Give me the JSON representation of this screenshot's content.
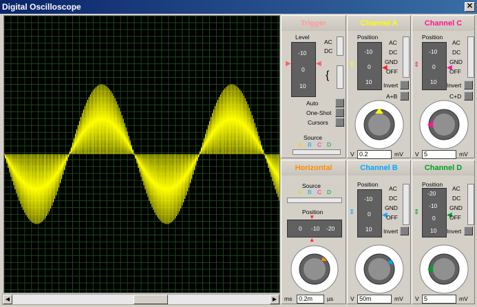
{
  "window": {
    "title": "Digital Oscilloscope",
    "close_glyph": "✕"
  },
  "colors": {
    "trace": "#ffff00",
    "grid": "#1a4a1a",
    "channel_a": "#ffff00",
    "channel_b": "#00a8ff",
    "channel_c": "#ff1493",
    "channel_d": "#00a020",
    "trigger": "#ff6060",
    "horizontal": "#ff8c00"
  },
  "trigger": {
    "title": "Trigger",
    "level_label": "Level",
    "ac": "AC",
    "dc": "DC",
    "scale": [
      "-10",
      "0",
      "10"
    ],
    "auto": "Auto",
    "one_shot": "One-Shot",
    "cursors": "Cursors",
    "source_label": "Source",
    "sources": [
      "A",
      "B",
      "C",
      "D"
    ]
  },
  "horizontal": {
    "title": "Horizontal",
    "source_label": "Source",
    "sources": [
      "A",
      "B",
      "C",
      "D"
    ],
    "position_label": "Position",
    "scale": [
      "0",
      "-10",
      "-20"
    ],
    "dial_ticks": [
      "0.2",
      "0.1",
      "0.5",
      "1",
      "2",
      "5",
      "10",
      "20",
      "50",
      "100",
      "200",
      "0.50",
      "2.0",
      "0.5",
      "1"
    ],
    "value": "0.2m",
    "unit_left": "ms",
    "unit_right": "µs"
  },
  "channel_a": {
    "title": "Channel A",
    "position_label": "Position",
    "scale": [
      "-10",
      "0",
      "10"
    ],
    "ac": "AC",
    "dc": "DC",
    "gnd": "GND",
    "off": "OFF",
    "invert": "Invert",
    "combine": "A+B",
    "value": "0.2",
    "unit_left": "V",
    "unit_right": "mV",
    "dial_ticks": [
      "0.5",
      "0.2",
      "0.1",
      "1",
      "2",
      "5",
      "10",
      "20",
      "50",
      "20",
      "50",
      "100",
      "200",
      "5",
      "2"
    ]
  },
  "channel_b": {
    "title": "Channel B",
    "position_label": "Position",
    "scale": [
      "-10",
      "0",
      "10"
    ],
    "ac": "AC",
    "dc": "DC",
    "gnd": "GND",
    "off": "OFF",
    "invert": "Invert",
    "value": "50m",
    "unit_left": "V",
    "unit_right": "mV",
    "dial_ticks": [
      "0.5",
      "0.2",
      "0.1",
      "1",
      "2",
      "5",
      "10",
      "20",
      "50",
      "20",
      "50",
      "100",
      "200",
      "5",
      "2"
    ]
  },
  "channel_c": {
    "title": "Channel C",
    "position_label": "Position",
    "scale": [
      "-10",
      "0",
      "10"
    ],
    "ac": "AC",
    "dc": "DC",
    "gnd": "GND",
    "off": "OFF",
    "invert": "Invert",
    "combine": "C+D",
    "value": "5",
    "unit_left": "V",
    "unit_right": "mV",
    "dial_ticks": [
      "0.5",
      "0.2",
      "0.1",
      "1",
      "2",
      "5",
      "10",
      "20",
      "50",
      "20",
      "50",
      "100",
      "200",
      "5",
      "2"
    ]
  },
  "channel_d": {
    "title": "Channel D",
    "position_label": "Position",
    "scale": [
      "-20",
      "-10",
      "0",
      "10"
    ],
    "ac": "AC",
    "dc": "DC",
    "gnd": "GND",
    "off": "OFF",
    "invert": "Invert",
    "value": "5",
    "unit_left": "V",
    "unit_right": "mV",
    "dial_ticks": [
      "0.5",
      "0.2",
      "0.1",
      "1",
      "2",
      "5",
      "10",
      "20",
      "50",
      "20",
      "50",
      "100",
      "200",
      "5",
      "2"
    ]
  },
  "icons": {
    "close": "close-icon",
    "scroll_left": "arrow-left-icon",
    "scroll_right": "arrow-right-icon"
  }
}
